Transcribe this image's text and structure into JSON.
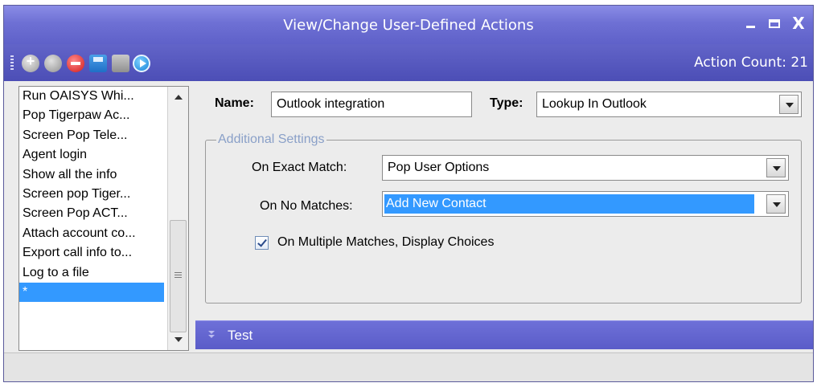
{
  "window": {
    "title": "View/Change User-Defined Actions"
  },
  "toolbar": {
    "icons": [
      "add-icon",
      "copy-icon",
      "delete-icon",
      "save-icon",
      "export-icon",
      "run-icon"
    ],
    "action_count": "Action Count: 21"
  },
  "actions_list": {
    "items": [
      "Run OAISYS Whi...",
      "Pop Tigerpaw Ac...",
      "Screen Pop Tele...",
      "Agent login",
      "Show all the info",
      "Screen pop Tiger...",
      "Screen Pop ACT...",
      "Attach account co...",
      "Export call info to...",
      "Log to a file",
      "*"
    ],
    "selected_index": 10
  },
  "form": {
    "name_label": "Name:",
    "name_value": "Outlook integration",
    "type_label": "Type:",
    "type_value": "Lookup In Outlook"
  },
  "additional_settings": {
    "legend": "Additional Settings",
    "exact_match_label": "On Exact Match:",
    "exact_match_value": "Pop User Options",
    "no_matches_label": "On No Matches:",
    "no_matches_value": "Add New Contact",
    "multiple_matches_label": "On Multiple Matches, Display Choices",
    "multiple_matches_checked": true
  },
  "test_panel": {
    "label": "Test"
  },
  "colors": {
    "title_bar": "#6e70d4",
    "selection": "#3399ff",
    "panel_bg": "#ececec"
  }
}
